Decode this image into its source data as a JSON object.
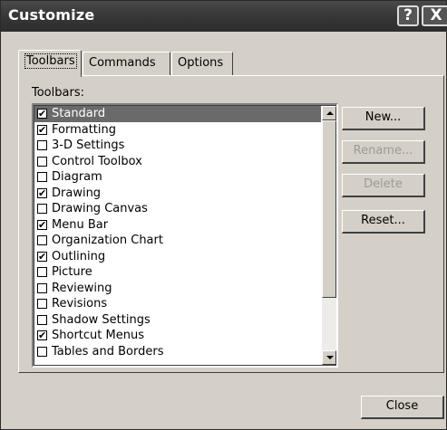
{
  "window": {
    "title": "Customize"
  },
  "titlebar_buttons": {
    "help": "?",
    "close": "X"
  },
  "tabs": [
    {
      "label": "Toolbars",
      "active": true
    },
    {
      "label": "Commands",
      "active": false
    },
    {
      "label": "Options",
      "active": false
    }
  ],
  "panel": {
    "label": "Toolbars:"
  },
  "toolbars": [
    {
      "label": "Standard",
      "checked": true,
      "selected": true
    },
    {
      "label": "Formatting",
      "checked": true,
      "selected": false
    },
    {
      "label": "3-D Settings",
      "checked": false,
      "selected": false
    },
    {
      "label": "Control Toolbox",
      "checked": false,
      "selected": false
    },
    {
      "label": "Diagram",
      "checked": false,
      "selected": false
    },
    {
      "label": "Drawing",
      "checked": true,
      "selected": false
    },
    {
      "label": "Drawing Canvas",
      "checked": false,
      "selected": false
    },
    {
      "label": "Menu Bar",
      "checked": true,
      "selected": false
    },
    {
      "label": "Organization Chart",
      "checked": false,
      "selected": false
    },
    {
      "label": "Outlining",
      "checked": true,
      "selected": false
    },
    {
      "label": "Picture",
      "checked": false,
      "selected": false
    },
    {
      "label": "Reviewing",
      "checked": false,
      "selected": false
    },
    {
      "label": "Revisions",
      "checked": false,
      "selected": false
    },
    {
      "label": "Shadow Settings",
      "checked": false,
      "selected": false
    },
    {
      "label": "Shortcut Menus",
      "checked": true,
      "selected": false
    },
    {
      "label": "Tables and Borders",
      "checked": false,
      "selected": false
    }
  ],
  "buttons": {
    "new": "New...",
    "rename": "Rename...",
    "delete": "Delete",
    "reset": "Reset...",
    "close": "Close"
  },
  "colors": {
    "dialog_bg": "#d4d0c8",
    "title_bar": "#373737",
    "selection": "#6a6a6a",
    "disabled_text": "#9c9a96"
  }
}
